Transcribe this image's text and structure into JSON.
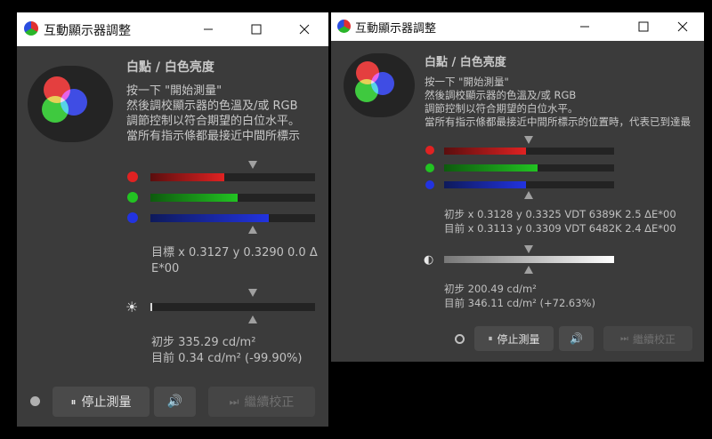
{
  "colors": {
    "red": "#e02222",
    "green": "#22c322",
    "blue": "#2233e0",
    "panel": "#3b3b3b",
    "track": "#232323"
  },
  "window1": {
    "title": "互動顯示器調整",
    "heading": "白點 / 白色亮度",
    "instructions": [
      "按一下 \"開始測量\"",
      "然後調校顯示器的色溫及/或 RGB",
      "調節控制以符合期望的白位水平。",
      "當所有指示條都最接近中間所標示"
    ],
    "bars": {
      "red": 0.45,
      "green": 0.53,
      "blue": 0.72,
      "luminance": 0.01
    },
    "target_line1": "目標 x 0.3127 y 0.3290 0.0 Δ",
    "target_line2": "E*00",
    "lum_initial": "初步 335.29 cd/m²",
    "lum_current": "目前 0.34 cd/m² (-99.90%)",
    "buttons": {
      "stop": "停止測量",
      "continue": "繼續校正"
    },
    "icons": {
      "sun": "☀",
      "speaker": "🔊",
      "pause": "⏸",
      "skip": "⏭"
    }
  },
  "window2": {
    "title": "互動顯示器調整",
    "heading": "白點 / 白色亮度",
    "instructions": [
      "按一下 \"開始測量\"",
      "然後調校顯示器的色溫及/或 RGB",
      "調節控制以符合期望的白位水平。",
      "當所有指示條都最接近中間所標示的位置時，代表已到達最"
    ],
    "bars": {
      "red": 0.48,
      "green": 0.55,
      "blue": 0.48,
      "luminance": 1.0
    },
    "initial": "初步 x 0.3128 y 0.3325 VDT 6389K 2.5 ΔE*00",
    "current": "目前 x 0.3113 y 0.3309 VDT 6482K 2.4 ΔE*00",
    "lum_initial": "初步 200.49 cd/m²",
    "lum_current": "目前 346.11 cd/m² (+72.63%)",
    "buttons": {
      "stop": "停止測量",
      "continue": "繼續校正"
    },
    "icons": {
      "contrast": "◐",
      "speaker": "🔊",
      "pause": "⏸",
      "skip": "⏭"
    }
  }
}
